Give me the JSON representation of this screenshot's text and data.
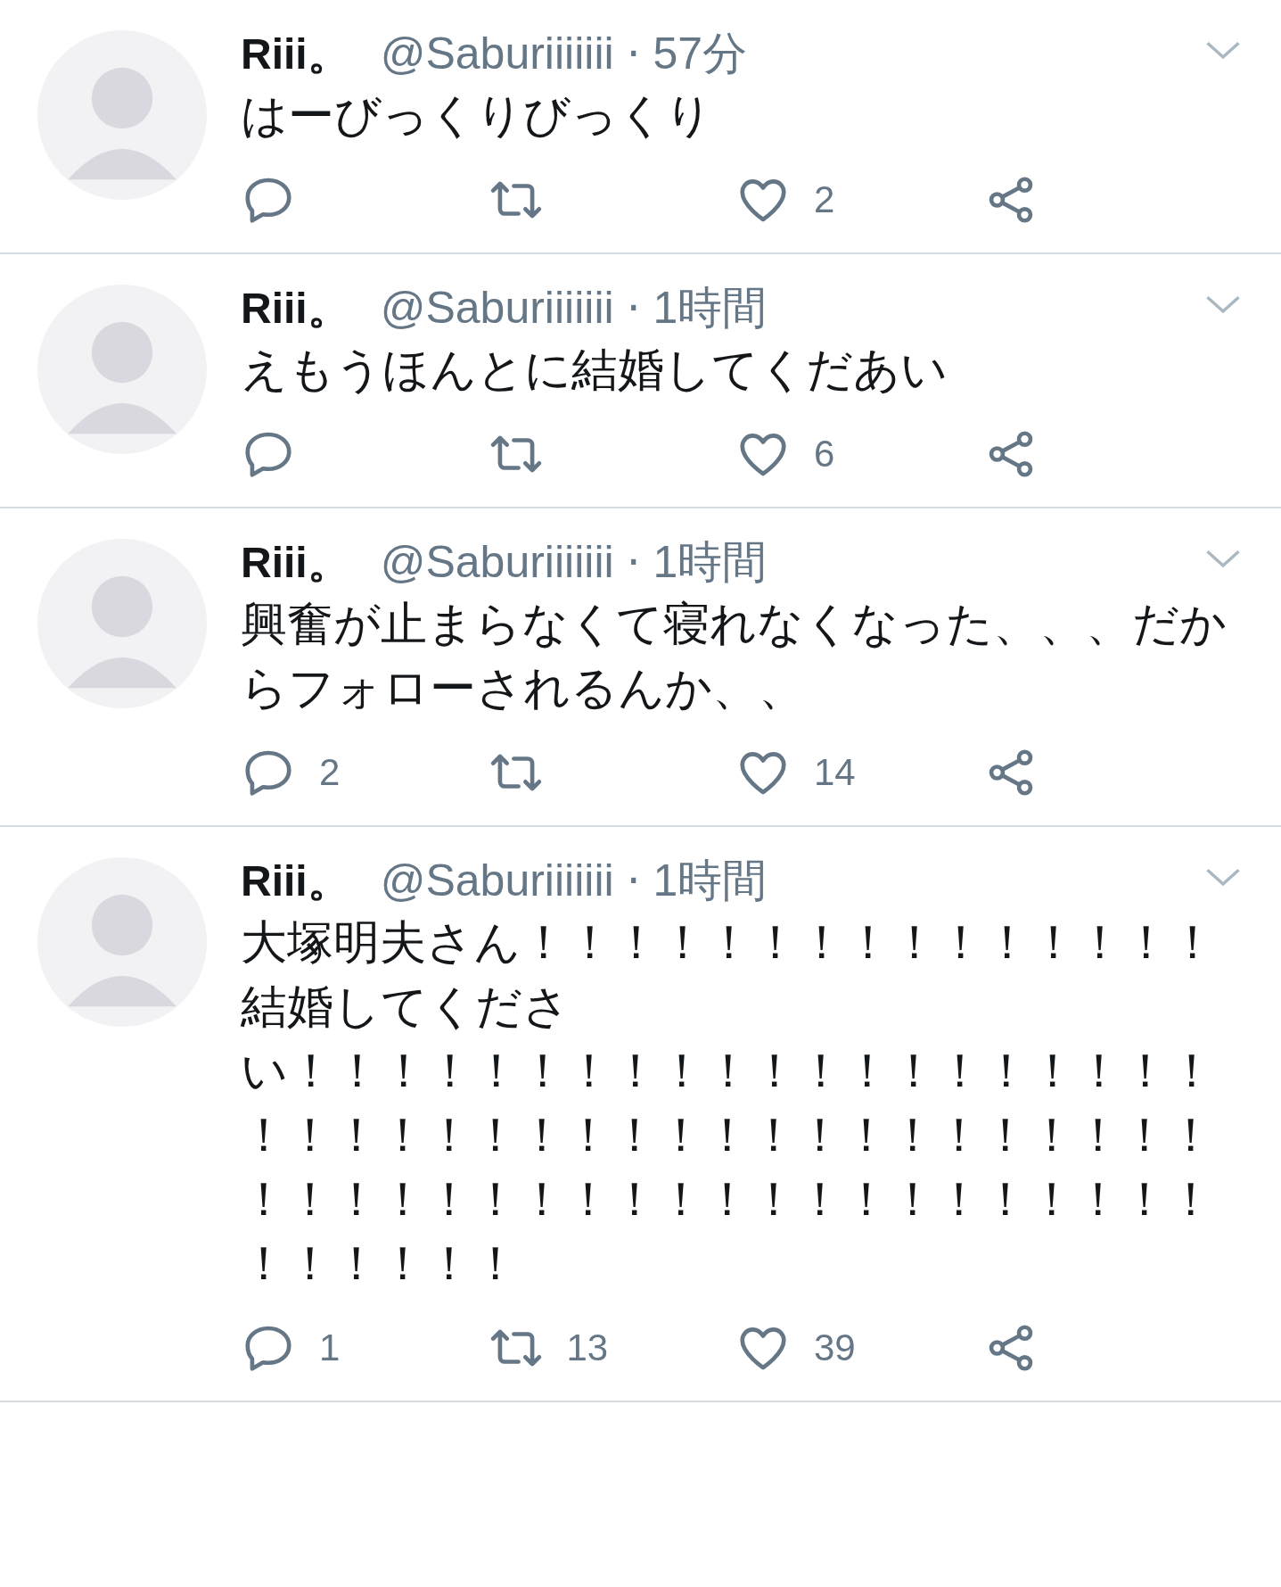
{
  "tweets": [
    {
      "name": "Riii。",
      "handle": "@Saburiiiiiii",
      "separator": "·",
      "time": "57分",
      "text": "はーびっくりびっくり",
      "actions": [
        {
          "kind": "reply"
        },
        {
          "kind": "retweet"
        },
        {
          "kind": "like",
          "count": "2"
        },
        {
          "kind": "share"
        }
      ]
    },
    {
      "name": "Riii。",
      "handle": "@Saburiiiiiii",
      "separator": "·",
      "time": "1時間",
      "text": "えもうほんとに結婚してくだあい",
      "actions": [
        {
          "kind": "reply"
        },
        {
          "kind": "retweet"
        },
        {
          "kind": "like",
          "count": "6"
        },
        {
          "kind": "share"
        }
      ]
    },
    {
      "name": "Riii。",
      "handle": "@Saburiiiiiii",
      "separator": "·",
      "time": "1時間",
      "text": "興奮が止まらなくて寝れなくなった、、、だからフォローされるんか、、",
      "actions": [
        {
          "kind": "reply",
          "count": "2"
        },
        {
          "kind": "retweet"
        },
        {
          "kind": "like",
          "count": "14"
        },
        {
          "kind": "share"
        }
      ]
    },
    {
      "name": "Riii。",
      "handle": "@Saburiiiiiii",
      "separator": "·",
      "time": "1時間",
      "text": "大塚明夫さん！！！！！！！！！！！！！！！結婚してください！！！！！！！！！！！！！！！！！！！！！！！！！！！！！！！！！！！！！！！！！！！！！！！！！！！！！！！！！！！！！！！！！！！！",
      "actions": [
        {
          "kind": "reply",
          "count": "1"
        },
        {
          "kind": "retweet",
          "count": "13"
        },
        {
          "kind": "like",
          "count": "39"
        },
        {
          "kind": "share"
        }
      ]
    }
  ]
}
